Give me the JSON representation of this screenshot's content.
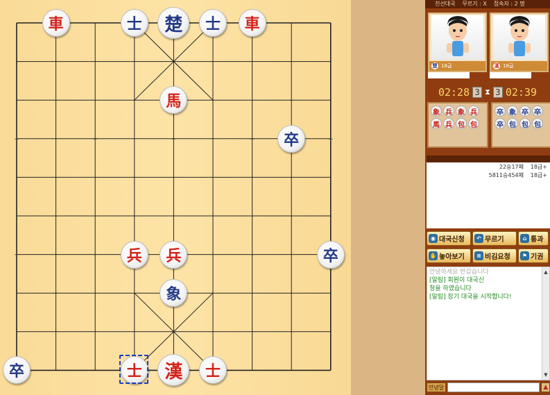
{
  "topbar": {
    "room": "친선대국",
    "undo": "무르기 : X",
    "viewers": "접속자 : 2 명"
  },
  "players": [
    {
      "level": "18급",
      "tag": "楚"
    },
    {
      "level": "18급",
      "tag": "漢"
    }
  ],
  "timer": {
    "left_time": "02:28",
    "left_count": "3",
    "right_count": "3",
    "right_time": "02:39",
    "sep": "⧗"
  },
  "captured": {
    "left": [
      {
        "c": "象",
        "s": "red"
      },
      {
        "c": "兵",
        "s": "red"
      },
      {
        "c": "象",
        "s": "red"
      },
      {
        "c": "兵",
        "s": "red"
      },
      {
        "c": "馬",
        "s": "red"
      },
      {
        "c": "兵",
        "s": "red"
      },
      {
        "c": "包",
        "s": "red"
      },
      {
        "c": "包",
        "s": "red"
      }
    ],
    "right": [
      {
        "c": "卒",
        "s": "blue"
      },
      {
        "c": "象",
        "s": "blue"
      },
      {
        "c": "卒",
        "s": "blue"
      },
      {
        "c": "卒",
        "s": "blue"
      },
      {
        "c": "卒",
        "s": "blue"
      },
      {
        "c": "包",
        "s": "blue"
      },
      {
        "c": "包",
        "s": "blue"
      },
      {
        "c": "包",
        "s": "blue"
      }
    ]
  },
  "user_list": [
    {
      "record": "22승17패",
      "grade": "18급+"
    },
    {
      "record": "5811승454패",
      "grade": "18급+"
    }
  ],
  "buttons": [
    {
      "label": "대국신청",
      "icon": "request-icon"
    },
    {
      "label": "무르기",
      "icon": "undo-icon"
    },
    {
      "label": "통과",
      "icon": "pass-icon"
    },
    {
      "label": "놓아보기",
      "icon": "hand-icon"
    },
    {
      "label": "비김요청",
      "icon": "draw-icon"
    },
    {
      "label": "기권",
      "icon": "resign-icon"
    }
  ],
  "chat": {
    "faded": "안녕하세요 반갑습니다",
    "lines": [
      "[알림]                    회원이 대국신",
      "청을 하였습니다",
      "[알림] 장기 대국을 시작합니다!"
    ]
  },
  "chat_label": "안녕말",
  "pieces": [
    {
      "c": "車",
      "side": "red",
      "col": 1,
      "row": 0
    },
    {
      "c": "士",
      "side": "blue",
      "col": 3,
      "row": 0
    },
    {
      "c": "楚",
      "side": "blue",
      "col": 4,
      "row": 0,
      "big": true
    },
    {
      "c": "士",
      "side": "blue",
      "col": 5,
      "row": 0
    },
    {
      "c": "車",
      "side": "red",
      "col": 6,
      "row": 0
    },
    {
      "c": "馬",
      "side": "red",
      "col": 4,
      "row": 2
    },
    {
      "c": "卒",
      "side": "blue",
      "col": 7,
      "row": 3
    },
    {
      "c": "兵",
      "side": "red",
      "col": 3,
      "row": 6
    },
    {
      "c": "兵",
      "side": "red",
      "col": 4,
      "row": 6
    },
    {
      "c": "卒",
      "side": "blue",
      "col": 8,
      "row": 6
    },
    {
      "c": "象",
      "side": "blue",
      "col": 4,
      "row": 7
    },
    {
      "c": "卒",
      "side": "blue",
      "col": 0,
      "row": 9
    },
    {
      "c": "士",
      "side": "red",
      "col": 3,
      "row": 9,
      "selected": true
    },
    {
      "c": "漢",
      "side": "red",
      "col": 4,
      "row": 9,
      "big": true
    },
    {
      "c": "士",
      "side": "red",
      "col": 5,
      "row": 9
    }
  ]
}
